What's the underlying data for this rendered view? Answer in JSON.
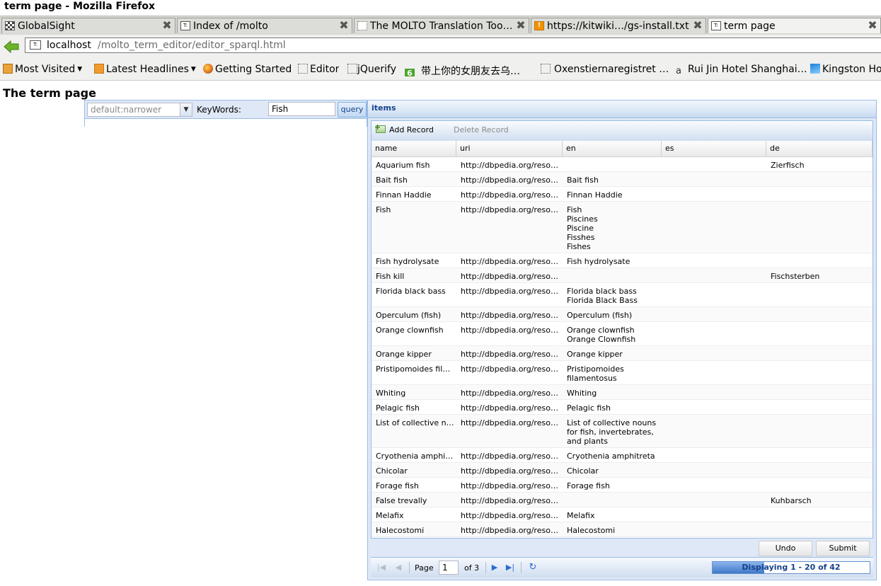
{
  "window": {
    "title": "term page - Mozilla Firefox"
  },
  "tabs": [
    {
      "label": "GlobalSight",
      "icon": "checker-favicon",
      "active": false
    },
    {
      "label": "Index of /molto",
      "icon": "page-favicon",
      "active": false
    },
    {
      "label": "The MOLTO Translation Too…",
      "icon": "blank-favicon",
      "active": false
    },
    {
      "label": "https://kitwiki…/gs-install.txt",
      "icon": "orange-favicon",
      "active": false
    },
    {
      "label": "term page",
      "icon": "page-favicon",
      "active": true
    }
  ],
  "url": {
    "host": "localhost",
    "path": "/molto_term_editor/editor_sparql.html"
  },
  "bookmarks": [
    {
      "label": "Most Visited",
      "icon": "most-visited-icon",
      "dropdown": true
    },
    {
      "label": "Latest Headlines",
      "icon": "rss-icon",
      "dropdown": true
    },
    {
      "label": "Getting Started",
      "icon": "firefox-icon"
    },
    {
      "label": "Editor",
      "icon": "blank-page-icon"
    },
    {
      "label": "jQuerify",
      "icon": "blank-page-icon"
    },
    {
      "label": "带上你的女朋友去乌…",
      "icon": "green-six-icon"
    },
    {
      "label": "Oxenstiernaregistret …",
      "icon": "blank-page-icon"
    },
    {
      "label": "Rui Jin Hotel Shanghai…",
      "icon": "amazon-icon"
    },
    {
      "label": "Kingston Ho",
      "icon": "wave-icon"
    }
  ],
  "page": {
    "title": "The term page"
  },
  "query_form": {
    "combo_placeholder": "default:narrower",
    "keywords_label": "KeyWords:",
    "keywords_value": "Fish",
    "query_button": "query"
  },
  "grid": {
    "title": "items",
    "toolbar": {
      "add": "Add Record",
      "delete": "Delete Record"
    },
    "columns": [
      "name",
      "uri",
      "en",
      "es",
      "de"
    ],
    "rows": [
      {
        "name": "Aquarium fish",
        "uri": "http://dbpedia.org/resource/Aquarium_fish",
        "en": [],
        "es": "",
        "de": "Zierfisch"
      },
      {
        "name": "Bait fish",
        "uri": "http://dbpedia.org/resource/Bait_fish",
        "en": [
          "Bait fish"
        ],
        "es": "",
        "de": ""
      },
      {
        "name": "Finnan Haddie",
        "uri": "http://dbpedia.org/resource/Finnan_Haddie",
        "en": [
          "Finnan Haddie"
        ],
        "es": "",
        "de": ""
      },
      {
        "name": "Fish",
        "uri": "http://dbpedia.org/resource/Fish",
        "en": [
          "Fish",
          "Piscines",
          "Piscine",
          "Fisshes",
          "Fishes"
        ],
        "es": "",
        "de": ""
      },
      {
        "name": "Fish hydrolysate",
        "uri": "http://dbpedia.org/resource/Fish_hydrolysate",
        "en": [
          "Fish hydrolysate"
        ],
        "es": "",
        "de": ""
      },
      {
        "name": "Fish kill",
        "uri": "http://dbpedia.org/resource/Fish_kill",
        "en": [],
        "es": "",
        "de": "Fischsterben"
      },
      {
        "name": "Florida black bass",
        "uri": "http://dbpedia.org/resource/Florida_black_bass",
        "en": [
          "Florida black bass",
          "Florida Black Bass"
        ],
        "es": "",
        "de": ""
      },
      {
        "name": "Operculum (fish)",
        "uri": "http://dbpedia.org/resource/Operculum_(fish)",
        "en": [
          "Operculum (fish)"
        ],
        "es": "",
        "de": ""
      },
      {
        "name": "Orange clownfish",
        "uri": "http://dbpedia.org/resource/Orange_clownfish",
        "en": [
          "Orange clownfish",
          "Orange Clownfish"
        ],
        "es": "",
        "de": ""
      },
      {
        "name": "Orange kipper",
        "uri": "http://dbpedia.org/resource/Orange_kipper",
        "en": [
          "Orange kipper"
        ],
        "es": "",
        "de": ""
      },
      {
        "name": "Pristipomoides filamentosus",
        "uri": "http://dbpedia.org/resource/Pristipomoides_filamentosus",
        "en": [
          "Pristipomoides",
          "filamentosus"
        ],
        "es": "",
        "de": ""
      },
      {
        "name": "Whiting",
        "uri": "http://dbpedia.org/resource/Whiting",
        "en": [
          "Whiting"
        ],
        "es": "",
        "de": ""
      },
      {
        "name": "Pelagic fish",
        "uri": "http://dbpedia.org/resource/Pelagic_fish",
        "en": [
          "Pelagic fish"
        ],
        "es": "",
        "de": ""
      },
      {
        "name": "List of collective nouns for fish, invertebrates, and plants",
        "uri": "http://dbpedia.org/resource/List_of_collective_nouns",
        "en": [
          "List of collective nouns",
          "for fish, invertebrates,",
          "and plants"
        ],
        "es": "",
        "de": ""
      },
      {
        "name": "Cryothenia amphitreta",
        "uri": "http://dbpedia.org/resource/Cryothenia_amphitreta",
        "en": [
          "Cryothenia amphitreta"
        ],
        "es": "",
        "de": ""
      },
      {
        "name": "Chicolar",
        "uri": "http://dbpedia.org/resource/Chicolar",
        "en": [
          "Chicolar"
        ],
        "es": "",
        "de": ""
      },
      {
        "name": "Forage fish",
        "uri": "http://dbpedia.org/resource/Forage_fish",
        "en": [
          "Forage fish"
        ],
        "es": "",
        "de": ""
      },
      {
        "name": "False trevally",
        "uri": "http://dbpedia.org/resource/False_trevally",
        "en": [],
        "es": "",
        "de": "Kuhbarsch"
      },
      {
        "name": "Melafix",
        "uri": "http://dbpedia.org/resource/Melafix",
        "en": [
          "Melafix"
        ],
        "es": "",
        "de": ""
      },
      {
        "name": "Halecostomi",
        "uri": "http://dbpedia.org/resource/Halecostomi",
        "en": [
          "Halecostomi"
        ],
        "es": "",
        "de": ""
      }
    ],
    "buttons": {
      "undo": "Undo",
      "submit": "Submit"
    },
    "pager": {
      "page_label": "Page",
      "page_value": "1",
      "of_label": "of 3",
      "display_text": "Displaying 1 - 20 of 42",
      "progress": 0.33
    }
  },
  "colors": {
    "accent": "#15428b",
    "panel_border": "#99bbe8",
    "panel_bg": "#dfe8f6"
  }
}
